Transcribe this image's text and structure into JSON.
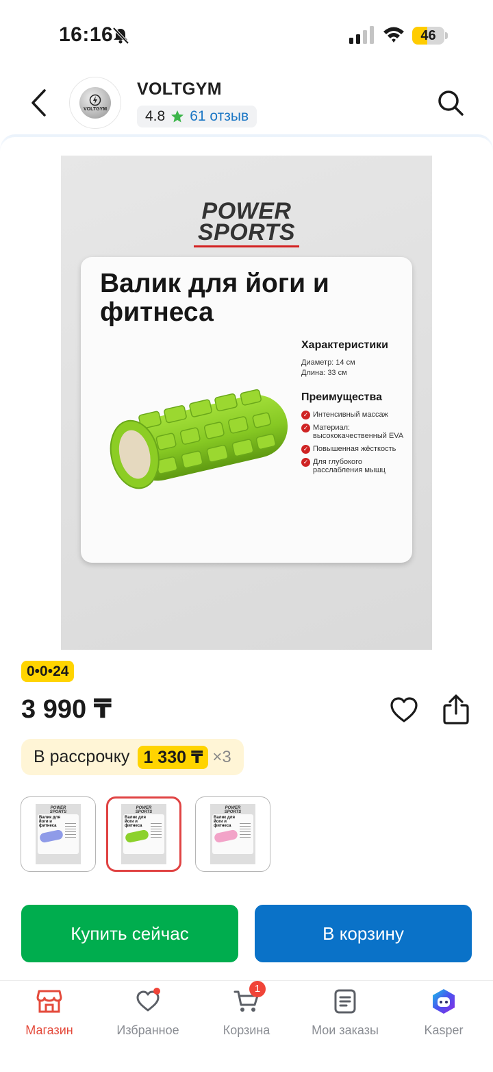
{
  "status_bar": {
    "time": "16:16",
    "battery": "46",
    "battery_level": 0.46
  },
  "header": {
    "store_name": "VOLTGYM",
    "store_logo_text": "VOLTGYM",
    "rating": "4.8",
    "reviews": "61 отзыв"
  },
  "product": {
    "image": {
      "brand_line1": "POWER",
      "brand_line2": "SPORTS",
      "title": "Валик для йоги и фитнеса",
      "specs_title": "Характеристики",
      "specs": [
        "Диаметр: 14 см",
        "Длина: 33 см"
      ],
      "benefits_title": "Преимущества",
      "benefits": [
        "Интенсивный массаж",
        "Материал: высококачественный EVA",
        "Повышенная жёсткость",
        "Для глубокого расслабления мышц"
      ]
    },
    "deal_badge": "0•0•24",
    "price": "3 990 ₸",
    "installment": {
      "label": "В рассрочку",
      "amount": "1 330 ₸",
      "times": "×3"
    },
    "variants": [
      {
        "color": "#8f9be8",
        "selected": false
      },
      {
        "color": "#8cd12c",
        "selected": true
      },
      {
        "color": "#f2a3c8",
        "selected": false
      }
    ]
  },
  "actions": {
    "buy_now": "Купить сейчас",
    "add_to_cart": "В корзину"
  },
  "colors": {
    "accent_green": "#00ad4e",
    "accent_blue": "#0a72c8",
    "active_tab": "#e44a3b",
    "badge_yellow": "#ffd400"
  },
  "tab_bar": {
    "items": [
      {
        "label": "Магазин",
        "icon": "store-icon",
        "active": true
      },
      {
        "label": "Избранное",
        "icon": "heart-icon"
      },
      {
        "label": "Корзина",
        "icon": "cart-icon",
        "badge": "1"
      },
      {
        "label": "Мои заказы",
        "icon": "orders-icon"
      },
      {
        "label": "Kasper",
        "icon": "kasper-assistant-icon"
      }
    ]
  }
}
